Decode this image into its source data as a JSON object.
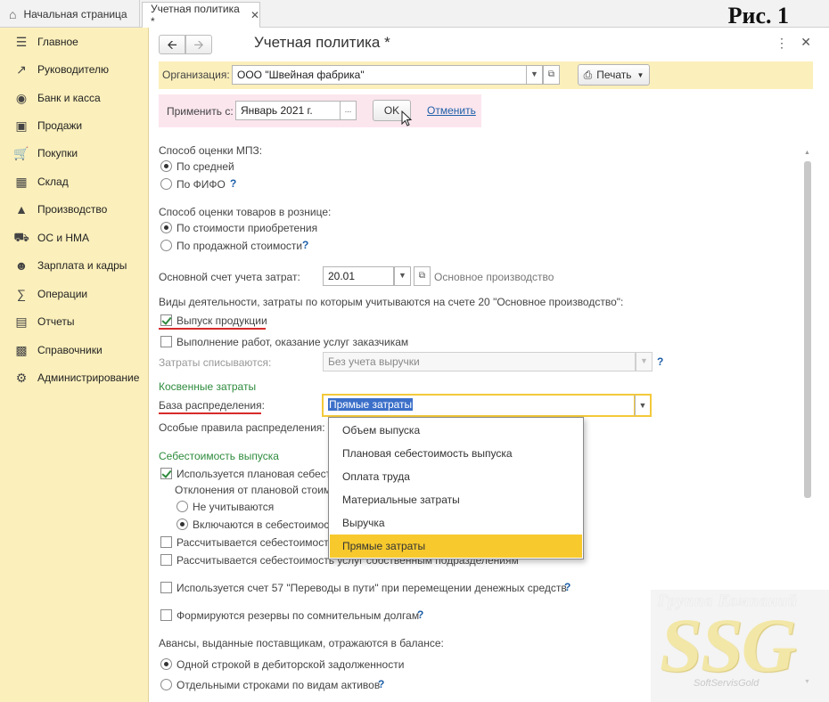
{
  "tabs": {
    "home_label": "Начальная страница",
    "active_label": "Учетная политика *"
  },
  "figure_label": "Рис. 1",
  "sidebar": {
    "items": [
      {
        "label": "Главное",
        "icon": "menu-lines-icon"
      },
      {
        "label": "Руководителю",
        "icon": "trend-chart-icon"
      },
      {
        "label": "Банк и касса",
        "icon": "coin-icon"
      },
      {
        "label": "Продажи",
        "icon": "shopping-bag-icon"
      },
      {
        "label": "Покупки",
        "icon": "cart-icon"
      },
      {
        "label": "Склад",
        "icon": "warehouse-grid-icon"
      },
      {
        "label": "Производство",
        "icon": "factory-icon"
      },
      {
        "label": "ОС и НМА",
        "icon": "truck-icon"
      },
      {
        "label": "Зарплата и кадры",
        "icon": "person-icon"
      },
      {
        "label": "Операции",
        "icon": "operations-icon"
      },
      {
        "label": "Отчеты",
        "icon": "bar-chart-icon"
      },
      {
        "label": "Справочники",
        "icon": "books-icon"
      },
      {
        "label": "Администрирование",
        "icon": "gear-icon"
      }
    ]
  },
  "header": {
    "title": "Учетная политика *"
  },
  "org": {
    "label": "Организация:",
    "value": "ООО \"Швейная фабрика\"",
    "print_label": "Печать"
  },
  "apply": {
    "label": "Применить с:",
    "date_value": "Январь 2021 г.",
    "pick_label": "...",
    "ok_label": "OK",
    "cancel_label": "Отменить"
  },
  "form": {
    "mpz_title": "Способ оценки МПЗ:",
    "mpz_avg": "По средней",
    "mpz_fifo": "По ФИФО",
    "retail_title": "Способ оценки товаров в рознице:",
    "retail_cost": "По стоимости приобретения",
    "retail_sale": "По продажной стоимости",
    "account_label": "Основной счет учета затрат:",
    "account_value": "20.01",
    "account_name": "Основное производство",
    "activities_title": "Виды деятельности, затраты по которым учитываются на счете 20 \"Основное производство\":",
    "act_products": "Выпуск продукции",
    "act_services": "Выполнение работ, оказание услуг заказчикам",
    "writeoff_label": "Затраты списываются:",
    "writeoff_value": "Без учета выручки",
    "indirect_title": "Косвенные затраты",
    "base_label": "База распределения:",
    "base_value": "Прямые затраты",
    "special_rules": "Особые правила распределения:",
    "cost_title": "Себестоимость выпуска",
    "plan_cost": "Используется плановая себестоимость",
    "deviations": "Отклонения от плановой стоимости",
    "dev_none": "Не учитываются",
    "dev_incl": "Включаются в себестоимость",
    "calc_cost_1": "Рассчитывается себестоимость",
    "calc_cost_2": "Рассчитывается себестоимость услуг собственным подразделениям",
    "acc57": "Используется счет 57 \"Переводы в пути\" при перемещении денежных средств",
    "reserves": "Формируются резервы по сомнительным долгам",
    "advances_title": "Авансы, выданные поставщикам, отражаются в балансе:",
    "adv_one_line": "Одной строкой в дебиторской задолженности",
    "adv_separate": "Отдельными строками по видам активов",
    "help": "?"
  },
  "dropdown": {
    "options": [
      "Объем выпуска",
      "Плановая себестоимость выпуска",
      "Оплата труда",
      "Материальные затраты",
      "Выручка",
      "Прямые затраты"
    ],
    "selected_index": 5
  },
  "watermark": {
    "top": "Группа Компаний",
    "big": "SSG",
    "small": "SoftServisGold"
  },
  "colors": {
    "sidebar_bg": "#fbefbb",
    "accent_yellow": "#f7c92d",
    "section_green": "#2e8b3d",
    "link_blue": "#1d5fa8",
    "underline_red": "#d62b2b"
  }
}
